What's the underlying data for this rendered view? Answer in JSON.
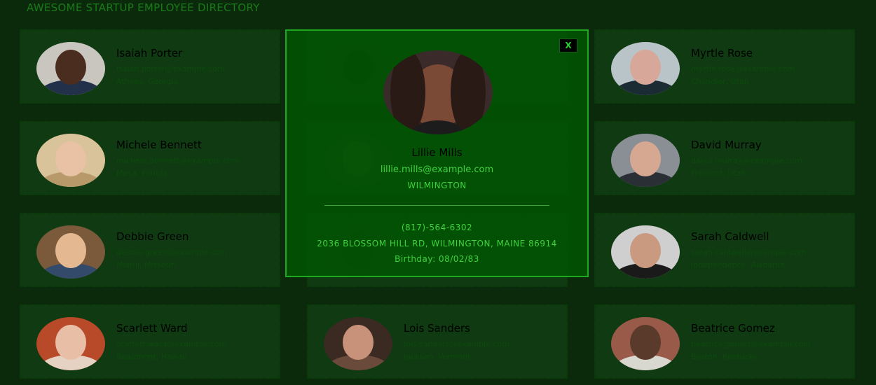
{
  "page": {
    "title": "AWESOME STARTUP EMPLOYEE DIRECTORY"
  },
  "employees": [
    {
      "name": "Isaiah Porter",
      "email": "isaiah.porter@example.com",
      "location": "Athens, Georgia"
    },
    {
      "name": "",
      "email": "",
      "location": ""
    },
    {
      "name": "Myrtle Rose",
      "email": "myrtle.rose@example.com",
      "location": "Chandler, Utah"
    },
    {
      "name": "Michele Bennett",
      "email": "michele.bennett@example.com",
      "location": "Mesa, Florida"
    },
    {
      "name": "",
      "email": "",
      "location": ""
    },
    {
      "name": "David Murray",
      "email": "david.murray@example.com",
      "location": "Fremont, Utah"
    },
    {
      "name": "Debbie Green",
      "email": "debbie.green@example.com",
      "location": "Miami, Missouri"
    },
    {
      "name": "",
      "email": "",
      "location": ""
    },
    {
      "name": "Sarah Caldwell",
      "email": "sarah.caldwell@example.com",
      "location": "Independence, Alabama"
    },
    {
      "name": "Scarlett Ward",
      "email": "scarlett.ward@example.com",
      "location": "Beaumont, Hawaii"
    },
    {
      "name": "Lois Sanders",
      "email": "lois.sanders@example.com",
      "location": "Jackson, Vermont"
    },
    {
      "name": "Beatrice Gomez",
      "email": "beatrice.gomez@example.com",
      "location": "Boston, Kentucky"
    }
  ],
  "modal": {
    "close_label": "X",
    "name": "Lillie Mills",
    "email": "lillie.mills@example.com",
    "city": "WILMINGTON",
    "phone": "(817)-564-6302",
    "address": "2036 BLOSSOM HILL RD, WILMINGTON, MAINE 86914",
    "birthday": "Birthday: 08/02/83"
  },
  "colors": {
    "background": "#0b2a0b",
    "card": "#0f3a12",
    "modal_border": "#1fa81f",
    "accent_text": "#3fd13f"
  }
}
